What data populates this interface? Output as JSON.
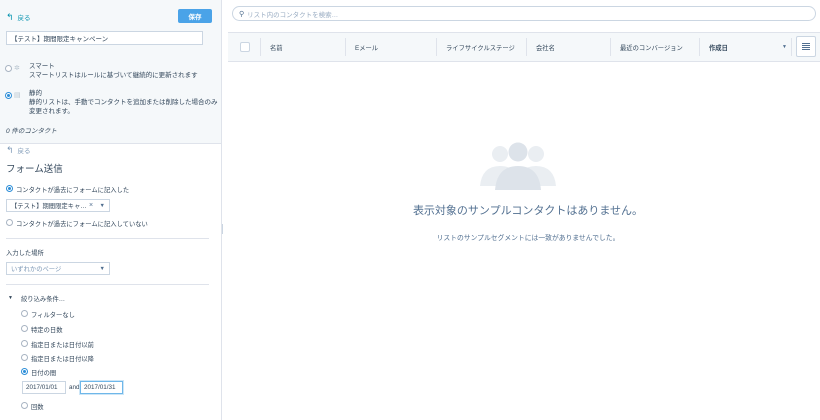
{
  "left": {
    "back_label": "戻る",
    "save_label": "保存",
    "list_name": "【テスト】期間限定キャンペーン",
    "smart": {
      "title": "スマート",
      "desc": "スマートリストはルールに基づいて継続的に更新されます"
    },
    "static": {
      "title": "静的",
      "desc1": "静的リストは、手動でコンタクトを追加または削除した場合のみ",
      "desc2": "変更されます。"
    },
    "contact_count": "0 件のコンタクト",
    "back_label_2": "戻る",
    "section_title": "フォーム送信",
    "opt_submitted": "コンタクトが過去にフォームに記入した",
    "form_select": "【テスト】期間限定キャ…",
    "opt_not_submitted": "コンタクトが過去にフォームに記入していない",
    "where_label": "入力した場所",
    "where_select": "いずれかのページ",
    "refine_label": "絞り込み条件…",
    "filters": [
      "フィルターなし",
      "特定の日数",
      "指定日または日付以前",
      "指定日または日付以降",
      "日付の間"
    ],
    "date_from": "2017/01/01",
    "and_label": "and",
    "date_to": "2017/01/31",
    "filter_count": "回数"
  },
  "right": {
    "search_placeholder": "リスト内のコンタクトを検索…",
    "columns": [
      "名前",
      "Eメール",
      "ライフサイクルステージ",
      "会社名",
      "最近のコンバージョン",
      "作成日"
    ],
    "empty_title": "表示対象のサンプルコンタクトはありません。",
    "empty_sub": "リストのサンプルセグメントには一致がありませんでした。"
  },
  "colors": {
    "accent": "#4aa3e8",
    "link": "#0091ae",
    "text": "#33475b"
  },
  "icons": [
    "back-arrow-icon",
    "smart-gear-icon",
    "static-list-icon",
    "search-icon",
    "people-icon",
    "grid-icon"
  ]
}
